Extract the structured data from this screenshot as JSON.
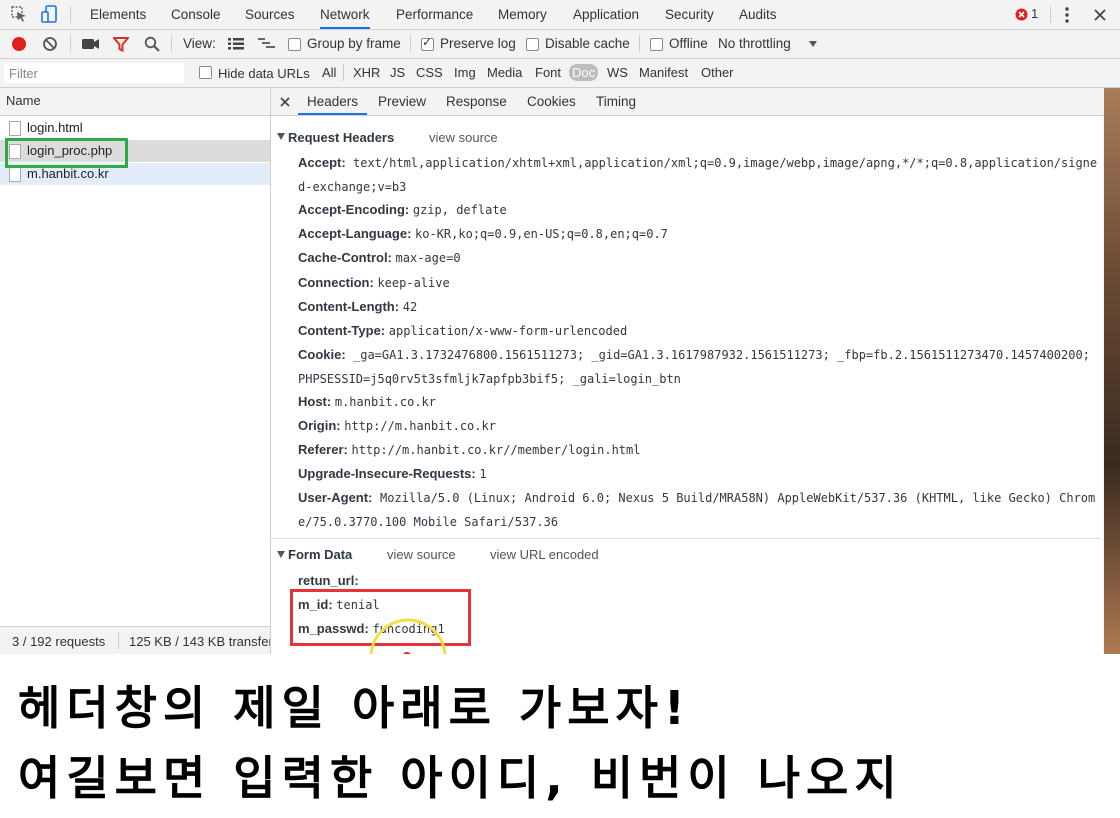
{
  "tabs": [
    "Elements",
    "Console",
    "Sources",
    "Network",
    "Performance",
    "Memory",
    "Application",
    "Security",
    "Audits"
  ],
  "active_tab": "Network",
  "error_count": "1",
  "toolbar": {
    "view_label": "View:",
    "group_by_frame": "Group by frame",
    "preserve_log": "Preserve log",
    "disable_cache": "Disable cache",
    "offline": "Offline",
    "throttling": "No throttling"
  },
  "filterbar": {
    "placeholder": "Filter",
    "hide_data_urls": "Hide data URLs",
    "types": [
      "All",
      "XHR",
      "JS",
      "CSS",
      "Img",
      "Media",
      "Font",
      "Doc",
      "WS",
      "Manifest",
      "Other"
    ],
    "selected_type": "Doc"
  },
  "requests": {
    "header": "Name",
    "items": [
      "login.html",
      "login_proc.php",
      "m.hanbit.co.kr"
    ]
  },
  "status": {
    "requests": "3 / 192 requests",
    "transferred": "125 KB / 143 KB transferred"
  },
  "detail_tabs": [
    "Headers",
    "Preview",
    "Response",
    "Cookies",
    "Timing"
  ],
  "request_headers": {
    "title": "Request Headers",
    "view_source": "view source",
    "accept_key": "Accept:",
    "accept_val": "text/html,application/xhtml+xml,application/xml;q=0.9,image/webp,image/apng,*/*;q=0.8,application/signed-exchange;v=b3",
    "accept_encoding_key": "Accept-Encoding:",
    "accept_encoding_val": "gzip, deflate",
    "accept_language_key": "Accept-Language:",
    "accept_language_val": "ko-KR,ko;q=0.9,en-US;q=0.8,en;q=0.7",
    "cache_control_key": "Cache-Control:",
    "cache_control_val": "max-age=0",
    "connection_key": "Connection:",
    "connection_val": "keep-alive",
    "content_length_key": "Content-Length:",
    "content_length_val": "42",
    "content_type_key": "Content-Type:",
    "content_type_val": "application/x-www-form-urlencoded",
    "cookie_key": "Cookie:",
    "cookie_val": "_ga=GA1.3.1732476800.1561511273; _gid=GA1.3.1617987932.1561511273; _fbp=fb.2.1561511273470.1457400200; PHPSESSID=j5q0rv5t3sfmljk7apfpb3bif5; _gali=login_btn",
    "host_key": "Host:",
    "host_val": "m.hanbit.co.kr",
    "origin_key": "Origin:",
    "origin_val": "http://m.hanbit.co.kr",
    "referer_key": "Referer:",
    "referer_val": "http://m.hanbit.co.kr//member/login.html",
    "upgrade_key": "Upgrade-Insecure-Requests:",
    "upgrade_val": "1",
    "user_agent_key": "User-Agent:",
    "user_agent_val": "Mozilla/5.0 (Linux; Android 6.0; Nexus 5 Build/MRA58N) AppleWebKit/537.36 (KHTML, like Gecko) Chrome/75.0.3770.100 Mobile Safari/537.36"
  },
  "form_data": {
    "title": "Form Data",
    "view_source": "view source",
    "view_url_encoded": "view URL encoded",
    "retun_url_key": "retun_url:",
    "m_id_key": "m_id:",
    "m_id_val": "tenial",
    "m_passwd_key": "m_passwd:",
    "m_passwd_val": "funcoding1"
  },
  "caption": {
    "line1": "헤더창의 제일 아래로 가보자!",
    "line2": "여길보면 입력한 아이디, 비번이 나오지"
  },
  "colors": {
    "accent": "#1a73e8",
    "record": "#e0211b",
    "filter_icon": "#d93025",
    "highlight_green": "#2eaa4a",
    "highlight_red": "#e8323a",
    "cursor_yellow": "#f2e03a"
  }
}
